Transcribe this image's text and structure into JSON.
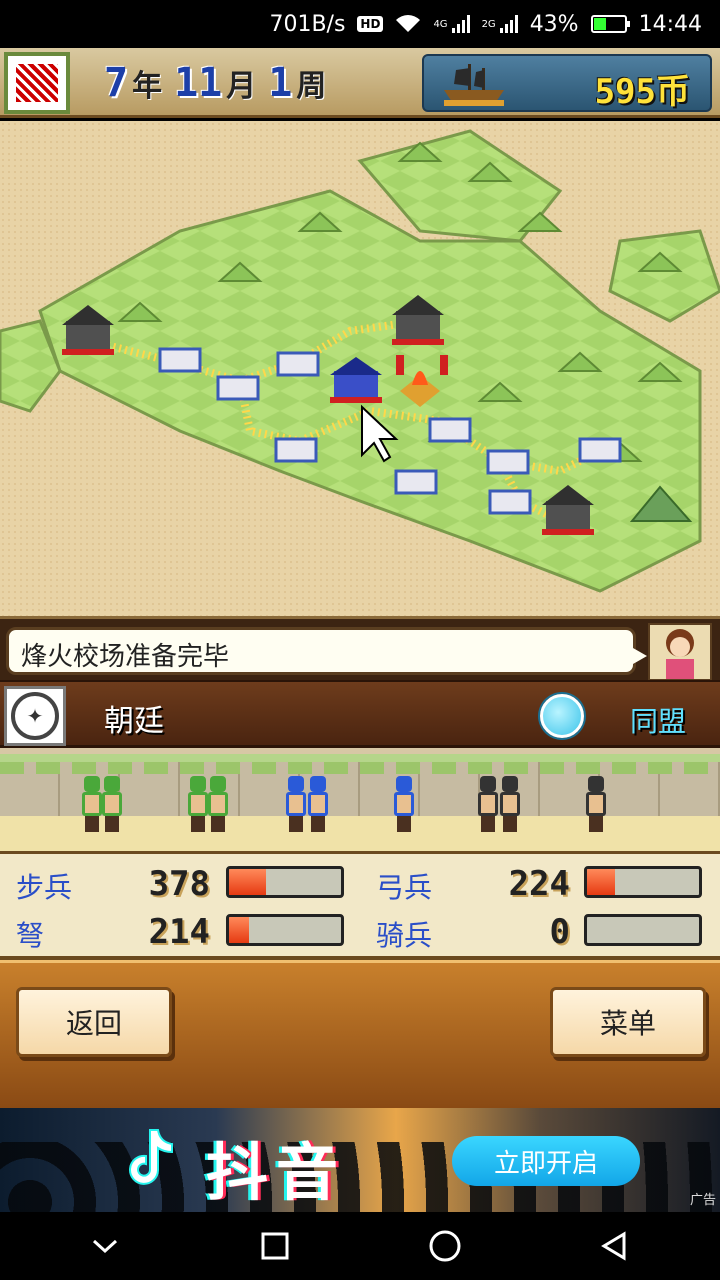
{
  "status_bar": {
    "net_speed": "701B/s",
    "hd_badge": "HD",
    "net_4g": "4G",
    "net_2g": "2G",
    "battery": "43%",
    "battery_level": 0.43,
    "time": "14:44"
  },
  "top_bar": {
    "year": "7",
    "year_unit": "年",
    "month": "11",
    "month_unit": "月",
    "week": "1",
    "week_unit": "周",
    "coins": "595币"
  },
  "message": {
    "text": "烽火校场准备完毕"
  },
  "faction": {
    "name": "朝廷",
    "status": "同盟"
  },
  "stats": [
    {
      "label": "步兵",
      "value": "378",
      "fill": 0.33
    },
    {
      "label": "弓兵",
      "value": "224",
      "fill": 0.25
    },
    {
      "label": "弩",
      "value": "214",
      "fill": 0.18
    },
    {
      "label": "骑兵",
      "value": "0",
      "fill": 0.0
    }
  ],
  "buttons": {
    "back": "返回",
    "menu": "菜单"
  },
  "ad": {
    "title": "抖音",
    "cta": "立即开启",
    "tag": "广告"
  },
  "colors": {
    "accent_blue": "#2a4ec8",
    "coin_yellow": "#ffe23a",
    "alliance_cyan": "#5fe0ff",
    "bar_red": "#e63a12"
  },
  "icons": [
    "signal-icon",
    "wifi-icon",
    "battery-icon",
    "ship-icon",
    "castle-icon",
    "bonfire-icon",
    "cursor-icon",
    "emblem-icon",
    "alliance-icon",
    "tiktok-icon",
    "nav-down-icon",
    "nav-recent-icon",
    "nav-home-icon",
    "nav-back-icon"
  ]
}
